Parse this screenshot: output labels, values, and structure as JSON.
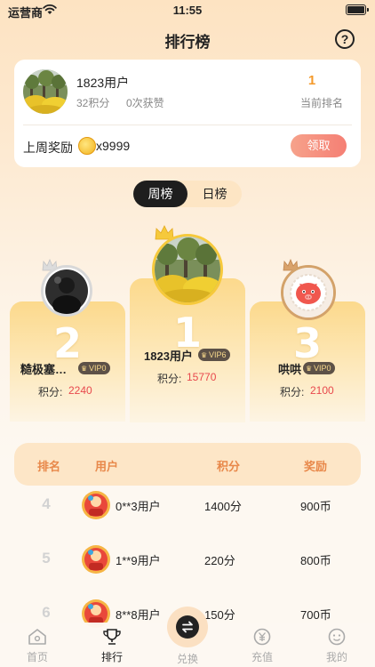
{
  "status_bar": {
    "carrier": "运营商",
    "time": "11:55"
  },
  "nav": {
    "title": "排行榜"
  },
  "user_card": {
    "name": "1823用户",
    "points": "32积分",
    "likes": "0次获赞",
    "rank": "1",
    "rank_label": "当前排名",
    "reward_label": "上周奖励",
    "reward_count": "x9999",
    "claim_label": "领取"
  },
  "tabs": {
    "weekly": "周榜",
    "daily": "日榜",
    "active": "weekly"
  },
  "podium": [
    {
      "place": "2",
      "name": "糙极塞…",
      "vip": "VIP0",
      "score_label": "积分:",
      "score": "2240"
    },
    {
      "place": "1",
      "name": "1823用户",
      "vip": "VIP6",
      "score_label": "积分:",
      "score": "15770"
    },
    {
      "place": "3",
      "name": "哄哄",
      "vip": "VIP0",
      "score_label": "积分:",
      "score": "2100"
    }
  ],
  "table": {
    "headers": {
      "rank": "排名",
      "user": "用户",
      "score": "积分",
      "reward": "奖励"
    },
    "rows": [
      {
        "rank": "4",
        "user": "0**3用户",
        "score": "1400分",
        "reward": "900币"
      },
      {
        "rank": "5",
        "user": "1**9用户",
        "score": "220分",
        "reward": "800币"
      },
      {
        "rank": "6",
        "user": "8**8用户",
        "score": "150分",
        "reward": "700币"
      }
    ]
  },
  "tabbar": {
    "home": "首页",
    "ranking": "排行",
    "exchange": "兑换",
    "recharge": "充值",
    "mine": "我的",
    "active": "ranking"
  },
  "colors": {
    "accent_orange": "#f49a2b",
    "claim_button": "#f57f74",
    "score_red": "#e8484d",
    "header_orange": "#e8884a"
  }
}
